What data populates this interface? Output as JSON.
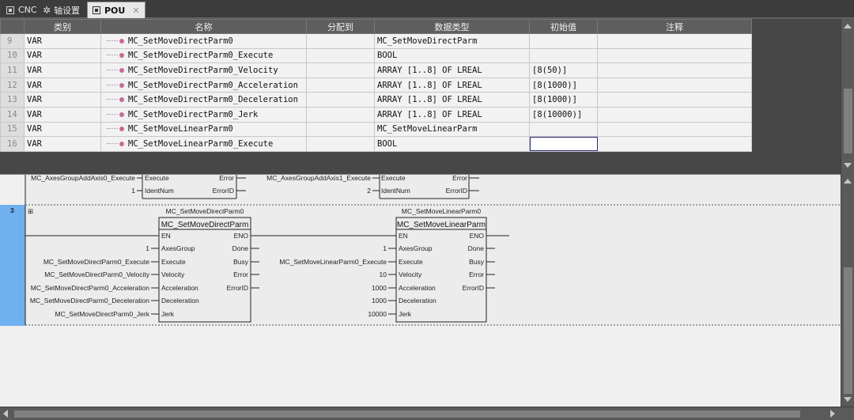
{
  "tabs": [
    {
      "label": "CNC",
      "icon": "window-icon"
    },
    {
      "label": "轴设置",
      "icon": "gear-icon"
    },
    {
      "label": "POU",
      "icon": "window-icon",
      "active": true,
      "close": "✕"
    }
  ],
  "var_table": {
    "headers": [
      "类别",
      "名称",
      "分配到",
      "数据类型",
      "初始值",
      "注释"
    ],
    "rows": [
      {
        "num": "9",
        "cat": "VAR",
        "name": "MC_SetMoveDirectParm0",
        "assign": "",
        "type": "MC_SetMoveDirectParm",
        "init": "",
        "comment": ""
      },
      {
        "num": "10",
        "cat": "VAR",
        "name": "MC_SetMoveDirectParm0_Execute",
        "assign": "",
        "type": "BOOL",
        "init": "",
        "comment": ""
      },
      {
        "num": "11",
        "cat": "VAR",
        "name": "MC_SetMoveDirectParm0_Velocity",
        "assign": "",
        "type": "ARRAY [1..8] OF LREAL",
        "init": "[8(50)]",
        "comment": ""
      },
      {
        "num": "12",
        "cat": "VAR",
        "name": "MC_SetMoveDirectParm0_Acceleration",
        "assign": "",
        "type": "ARRAY [1..8] OF LREAL",
        "init": "[8(1000)]",
        "comment": ""
      },
      {
        "num": "13",
        "cat": "VAR",
        "name": "MC_SetMoveDirectParm0_Deceleration",
        "assign": "",
        "type": "ARRAY [1..8] OF LREAL",
        "init": "[8(1000)]",
        "comment": ""
      },
      {
        "num": "14",
        "cat": "VAR",
        "name": "MC_SetMoveDirectParm0_Jerk",
        "assign": "",
        "type": "ARRAY [1..8] OF LREAL",
        "init": "[8(10000)]",
        "comment": ""
      },
      {
        "num": "15",
        "cat": "VAR",
        "name": "MC_SetMoveLinearParm0",
        "assign": "",
        "type": "MC_SetMoveLinearParm",
        "init": "",
        "comment": ""
      },
      {
        "num": "16",
        "cat": "VAR",
        "name": "MC_SetMoveLinearParm0_Execute",
        "assign": "",
        "type": "BOOL",
        "init": "",
        "comment": ""
      }
    ]
  },
  "ladder": {
    "prev_rung": {
      "block1": {
        "in_execute": "MC_AxesGroupAddAxis0_Execute",
        "in_identnum": "1",
        "pin_execute": "Execute",
        "pin_identnum": "IdentNum",
        "pin_error": "Error",
        "pin_errorid": "ErrorID"
      },
      "block2": {
        "in_execute": "MC_AxesGroupAddAxis1_Execute",
        "in_identnum": "2",
        "pin_execute": "Execute",
        "pin_identnum": "IdentNum",
        "pin_error": "Error",
        "pin_errorid": "ErrorID"
      }
    },
    "rung": {
      "number": "3",
      "expand": "⊞",
      "fb1": {
        "instance": "MC_SetMoveDirectParm0",
        "type": "MC_SetMoveDirectParm",
        "inputs": [
          "EN",
          "AxesGroup",
          "Execute",
          "Velocity",
          "Acceleration",
          "Deceleration",
          "Jerk"
        ],
        "outputs": [
          "ENO",
          "Done",
          "Busy",
          "Error",
          "ErrorID"
        ],
        "input_vars": [
          "",
          "1",
          "MC_SetMoveDirectParm0_Execute",
          "MC_SetMoveDirectParm0_Velocity",
          "MC_SetMoveDirectParm0_Acceleration",
          "MC_SetMoveDirectParm0_Deceleration",
          "MC_SetMoveDirectParm0_Jerk"
        ]
      },
      "fb2": {
        "instance": "MC_SetMoveLinearParm0",
        "type": "MC_SetMoveLinearParm",
        "inputs": [
          "EN",
          "AxesGroup",
          "Execute",
          "Velocity",
          "Acceleration",
          "Deceleration",
          "Jerk"
        ],
        "outputs": [
          "ENO",
          "Done",
          "Busy",
          "Error",
          "ErrorID"
        ],
        "input_vars": [
          "",
          "1",
          "MC_SetMoveLinearParm0_Execute",
          "10",
          "1000",
          "1000",
          "10000"
        ]
      }
    }
  }
}
